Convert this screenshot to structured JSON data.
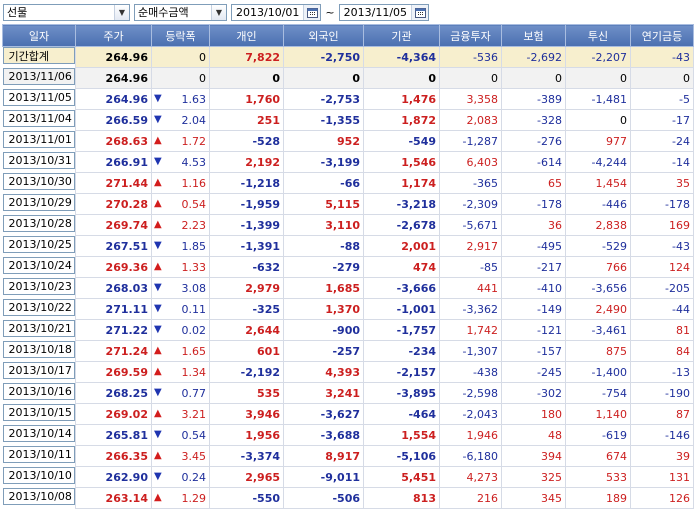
{
  "toolbar": {
    "market_select": "선물",
    "metric_select": "순매수금액",
    "start_date": "2013/10/01",
    "date_separator": "~",
    "end_date": "2013/11/05"
  },
  "table": {
    "headers": [
      "일자",
      "주가",
      "등락폭",
      "개인",
      "외국인",
      "기관",
      "금융투자",
      "보험",
      "투신",
      "연기금등"
    ],
    "total": {
      "label": "기간합계",
      "price": "264.96",
      "change": "0",
      "individual": "7,822",
      "foreign": "-2,750",
      "institution": "-4,364",
      "financial_investment": "-536",
      "insurance": "-2,692",
      "investment_trust": "-2,207",
      "pension": "-43"
    },
    "rows": [
      {
        "date": "2013/11/06",
        "price": "264.96",
        "direction": "",
        "change": "0",
        "individual": "0",
        "foreign": "0",
        "institution": "0",
        "financial_investment": "0",
        "insurance": "0",
        "investment_trust": "0",
        "pension": "0"
      },
      {
        "date": "2013/11/05",
        "price": "264.96",
        "direction": "down",
        "change": "1.63",
        "individual": "1,760",
        "foreign": "-2,753",
        "institution": "1,476",
        "financial_investment": "3,358",
        "insurance": "-389",
        "investment_trust": "-1,481",
        "pension": "-5"
      },
      {
        "date": "2013/11/04",
        "price": "266.59",
        "direction": "down",
        "change": "2.04",
        "individual": "251",
        "foreign": "-1,355",
        "institution": "1,872",
        "financial_investment": "2,083",
        "insurance": "-328",
        "investment_trust": "0",
        "pension": "-17"
      },
      {
        "date": "2013/11/01",
        "price": "268.63",
        "direction": "up",
        "change": "1.72",
        "individual": "-528",
        "foreign": "952",
        "institution": "-549",
        "financial_investment": "-1,287",
        "insurance": "-276",
        "investment_trust": "977",
        "pension": "-24"
      },
      {
        "date": "2013/10/31",
        "price": "266.91",
        "direction": "down",
        "change": "4.53",
        "individual": "2,192",
        "foreign": "-3,199",
        "institution": "1,546",
        "financial_investment": "6,403",
        "insurance": "-614",
        "investment_trust": "-4,244",
        "pension": "-14"
      },
      {
        "date": "2013/10/30",
        "price": "271.44",
        "direction": "up",
        "change": "1.16",
        "individual": "-1,218",
        "foreign": "-66",
        "institution": "1,174",
        "financial_investment": "-365",
        "insurance": "65",
        "investment_trust": "1,454",
        "pension": "35"
      },
      {
        "date": "2013/10/29",
        "price": "270.28",
        "direction": "up",
        "change": "0.54",
        "individual": "-1,959",
        "foreign": "5,115",
        "institution": "-3,218",
        "financial_investment": "-2,309",
        "insurance": "-178",
        "investment_trust": "-446",
        "pension": "-178"
      },
      {
        "date": "2013/10/28",
        "price": "269.74",
        "direction": "up",
        "change": "2.23",
        "individual": "-1,399",
        "foreign": "3,110",
        "institution": "-2,678",
        "financial_investment": "-5,671",
        "insurance": "36",
        "investment_trust": "2,838",
        "pension": "169"
      },
      {
        "date": "2013/10/25",
        "price": "267.51",
        "direction": "down",
        "change": "1.85",
        "individual": "-1,391",
        "foreign": "-88",
        "institution": "2,001",
        "financial_investment": "2,917",
        "insurance": "-495",
        "investment_trust": "-529",
        "pension": "-43"
      },
      {
        "date": "2013/10/24",
        "price": "269.36",
        "direction": "up",
        "change": "1.33",
        "individual": "-632",
        "foreign": "-279",
        "institution": "474",
        "financial_investment": "-85",
        "insurance": "-217",
        "investment_trust": "766",
        "pension": "124"
      },
      {
        "date": "2013/10/23",
        "price": "268.03",
        "direction": "down",
        "change": "3.08",
        "individual": "2,979",
        "foreign": "1,685",
        "institution": "-3,666",
        "financial_investment": "441",
        "insurance": "-410",
        "investment_trust": "-3,656",
        "pension": "-205"
      },
      {
        "date": "2013/10/22",
        "price": "271.11",
        "direction": "down",
        "change": "0.11",
        "individual": "-325",
        "foreign": "1,370",
        "institution": "-1,001",
        "financial_investment": "-3,362",
        "insurance": "-149",
        "investment_trust": "2,490",
        "pension": "-44"
      },
      {
        "date": "2013/10/21",
        "price": "271.22",
        "direction": "down",
        "change": "0.02",
        "individual": "2,644",
        "foreign": "-900",
        "institution": "-1,757",
        "financial_investment": "1,742",
        "insurance": "-121",
        "investment_trust": "-3,461",
        "pension": "81"
      },
      {
        "date": "2013/10/18",
        "price": "271.24",
        "direction": "up",
        "change": "1.65",
        "individual": "601",
        "foreign": "-257",
        "institution": "-234",
        "financial_investment": "-1,307",
        "insurance": "-157",
        "investment_trust": "875",
        "pension": "84"
      },
      {
        "date": "2013/10/17",
        "price": "269.59",
        "direction": "up",
        "change": "1.34",
        "individual": "-2,192",
        "foreign": "4,393",
        "institution": "-2,157",
        "financial_investment": "-438",
        "insurance": "-245",
        "investment_trust": "-1,400",
        "pension": "-13"
      },
      {
        "date": "2013/10/16",
        "price": "268.25",
        "direction": "down",
        "change": "0.77",
        "individual": "535",
        "foreign": "3,241",
        "institution": "-3,895",
        "financial_investment": "-2,598",
        "insurance": "-302",
        "investment_trust": "-754",
        "pension": "-190"
      },
      {
        "date": "2013/10/15",
        "price": "269.02",
        "direction": "up",
        "change": "3.21",
        "individual": "3,946",
        "foreign": "-3,627",
        "institution": "-464",
        "financial_investment": "-2,043",
        "insurance": "180",
        "investment_trust": "1,140",
        "pension": "87"
      },
      {
        "date": "2013/10/14",
        "price": "265.81",
        "direction": "down",
        "change": "0.54",
        "individual": "1,956",
        "foreign": "-3,688",
        "institution": "1,554",
        "financial_investment": "1,946",
        "insurance": "48",
        "investment_trust": "-619",
        "pension": "-146"
      },
      {
        "date": "2013/10/11",
        "price": "266.35",
        "direction": "up",
        "change": "3.45",
        "individual": "-3,374",
        "foreign": "8,917",
        "institution": "-5,106",
        "financial_investment": "-6,180",
        "insurance": "394",
        "investment_trust": "674",
        "pension": "39"
      },
      {
        "date": "2013/10/10",
        "price": "262.90",
        "direction": "down",
        "change": "0.24",
        "individual": "2,965",
        "foreign": "-9,011",
        "institution": "5,451",
        "financial_investment": "4,273",
        "insurance": "325",
        "investment_trust": "533",
        "pension": "131"
      },
      {
        "date": "2013/10/08",
        "price": "263.14",
        "direction": "up",
        "change": "1.29",
        "individual": "-550",
        "foreign": "-506",
        "institution": "813",
        "financial_investment": "216",
        "insurance": "345",
        "investment_trust": "189",
        "pension": "126"
      }
    ]
  },
  "colors": {
    "positive": "#cc1f1f",
    "negative": "#1f2f9c",
    "header": "#5a7dbc",
    "total_row": "#f7efce"
  },
  "icons": {
    "up": "triangle-up-icon",
    "down": "triangle-down-icon",
    "calendar": "calendar-icon",
    "dropdown": "chevron-down-icon"
  }
}
